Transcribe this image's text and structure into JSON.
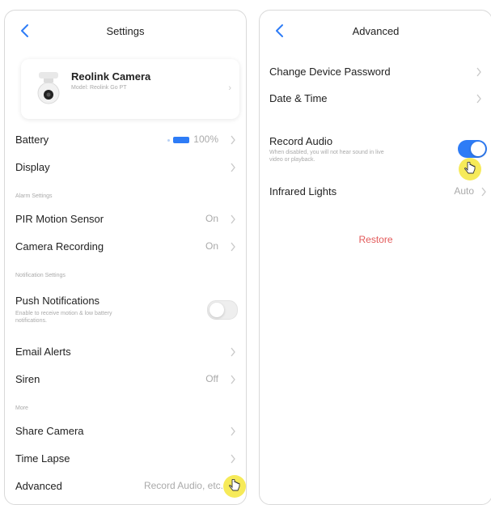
{
  "left": {
    "title": "Settings",
    "camera": {
      "name": "Reolink Camera",
      "model": "Model: Reolink Go PT"
    },
    "battery": {
      "label": "Battery",
      "value": "100%",
      "level": 1.0
    },
    "display": {
      "label": "Display"
    },
    "alarm_section": "Alarm Settings",
    "pir": {
      "label": "PIR Motion Sensor",
      "value": "On"
    },
    "recording": {
      "label": "Camera Recording",
      "value": "On"
    },
    "notification_section": "Notification Settings",
    "push": {
      "label": "Push Notifications",
      "sub": "Enable to receive motion & low battery notifications.",
      "enabled": false
    },
    "email": {
      "label": "Email Alerts"
    },
    "siren": {
      "label": "Siren",
      "value": "Off"
    },
    "more_section": "More",
    "share": {
      "label": "Share Camera"
    },
    "timelapse": {
      "label": "Time Lapse"
    },
    "advanced": {
      "label": "Advanced",
      "value": "Record Audio, etc."
    }
  },
  "right": {
    "title": "Advanced",
    "password": {
      "label": "Change Device Password"
    },
    "datetime": {
      "label": "Date & Time"
    },
    "audio": {
      "label": "Record Audio",
      "sub": "When disabled, you will not hear sound in live video or playback.",
      "enabled": true
    },
    "infrared": {
      "label": "Infrared Lights",
      "value": "Auto"
    },
    "restore": "Restore"
  },
  "colors": {
    "accent": "#2e7cf6",
    "danger": "#e35a5a",
    "highlight": "#f5e63c"
  }
}
